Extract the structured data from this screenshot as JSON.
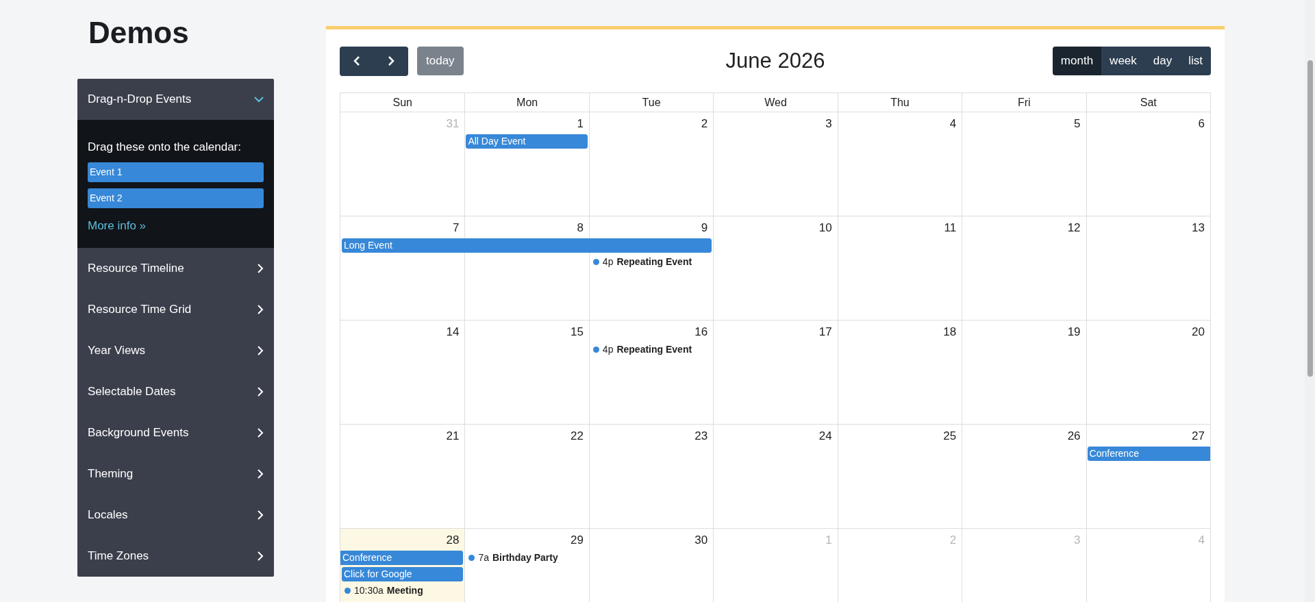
{
  "heading": "Demos",
  "sidebar": {
    "items": [
      {
        "label": "Drag-n-Drop Events",
        "expanded": true,
        "panel": {
          "intro": "Drag these onto the calendar:",
          "draggables": [
            "Event 1",
            "Event 2"
          ],
          "link": "More info »"
        }
      },
      {
        "label": "Resource Timeline",
        "expanded": false
      },
      {
        "label": "Resource Time Grid",
        "expanded": false
      },
      {
        "label": "Year Views",
        "expanded": false
      },
      {
        "label": "Selectable Dates",
        "expanded": false
      },
      {
        "label": "Background Events",
        "expanded": false
      },
      {
        "label": "Theming",
        "expanded": false
      },
      {
        "label": "Locales",
        "expanded": false
      },
      {
        "label": "Time Zones",
        "expanded": false
      }
    ]
  },
  "calendar": {
    "title": "June 2026",
    "today_button": {
      "label": "today",
      "disabled": true
    },
    "views": [
      {
        "label": "month",
        "selected": true
      },
      {
        "label": "week",
        "selected": false
      },
      {
        "label": "day",
        "selected": false
      },
      {
        "label": "list",
        "selected": false
      }
    ],
    "weekdays": [
      "Sun",
      "Mon",
      "Tue",
      "Wed",
      "Thu",
      "Fri",
      "Sat"
    ],
    "weeks": [
      {
        "days": [
          {
            "number": "31",
            "other_month": true,
            "today": false
          },
          {
            "number": "1",
            "other_month": false,
            "today": false
          },
          {
            "number": "2",
            "other_month": false,
            "today": false
          },
          {
            "number": "3",
            "other_month": false,
            "today": false
          },
          {
            "number": "4",
            "other_month": false,
            "today": false
          },
          {
            "number": "5",
            "other_month": false,
            "today": false
          },
          {
            "number": "6",
            "other_month": false,
            "today": false
          }
        ],
        "lanes": [
          [
            {
              "kind": "empty"
            },
            {
              "kind": "bar",
              "title": "All Day Event"
            },
            {
              "kind": "empty"
            },
            {
              "kind": "empty"
            },
            {
              "kind": "empty"
            },
            {
              "kind": "empty"
            },
            {
              "kind": "empty"
            }
          ]
        ]
      },
      {
        "days": [
          {
            "number": "7",
            "other_month": false,
            "today": false
          },
          {
            "number": "8",
            "other_month": false,
            "today": false
          },
          {
            "number": "9",
            "other_month": false,
            "today": false
          },
          {
            "number": "10",
            "other_month": false,
            "today": false
          },
          {
            "number": "11",
            "other_month": false,
            "today": false
          },
          {
            "number": "12",
            "other_month": false,
            "today": false
          },
          {
            "number": "13",
            "other_month": false,
            "today": false
          }
        ],
        "lanes": [
          [
            {
              "kind": "bar",
              "title": "Long Event"
            },
            {
              "kind": "bar_continued"
            },
            {
              "kind": "bar_continued"
            },
            {
              "kind": "empty"
            },
            {
              "kind": "empty"
            },
            {
              "kind": "empty"
            },
            {
              "kind": "empty"
            }
          ],
          [
            {
              "kind": "empty"
            },
            {
              "kind": "empty"
            },
            {
              "kind": "dot",
              "time": "4p",
              "title": "Repeating Event",
              "color": "#3788d8"
            },
            {
              "kind": "empty"
            },
            {
              "kind": "empty"
            },
            {
              "kind": "empty"
            },
            {
              "kind": "empty"
            }
          ]
        ]
      },
      {
        "days": [
          {
            "number": "14",
            "other_month": false,
            "today": false
          },
          {
            "number": "15",
            "other_month": false,
            "today": false
          },
          {
            "number": "16",
            "other_month": false,
            "today": false
          },
          {
            "number": "17",
            "other_month": false,
            "today": false
          },
          {
            "number": "18",
            "other_month": false,
            "today": false
          },
          {
            "number": "19",
            "other_month": false,
            "today": false
          },
          {
            "number": "20",
            "other_month": false,
            "today": false
          }
        ],
        "lanes": [
          [
            {
              "kind": "empty"
            },
            {
              "kind": "empty"
            },
            {
              "kind": "dot",
              "time": "4p",
              "title": "Repeating Event",
              "color": "#3788d8"
            },
            {
              "kind": "empty"
            },
            {
              "kind": "empty"
            },
            {
              "kind": "empty"
            },
            {
              "kind": "empty"
            }
          ]
        ]
      },
      {
        "days": [
          {
            "number": "21",
            "other_month": false,
            "today": false
          },
          {
            "number": "22",
            "other_month": false,
            "today": false
          },
          {
            "number": "23",
            "other_month": false,
            "today": false
          },
          {
            "number": "24",
            "other_month": false,
            "today": false
          },
          {
            "number": "25",
            "other_month": false,
            "today": false
          },
          {
            "number": "26",
            "other_month": false,
            "today": false
          },
          {
            "number": "27",
            "other_month": false,
            "today": false
          }
        ],
        "lanes": [
          [
            {
              "kind": "empty"
            },
            {
              "kind": "empty"
            },
            {
              "kind": "empty"
            },
            {
              "kind": "empty"
            },
            {
              "kind": "empty"
            },
            {
              "kind": "empty"
            },
            {
              "kind": "bar_open_end",
              "title": "Conference"
            }
          ]
        ]
      },
      {
        "days": [
          {
            "number": "28",
            "other_month": false,
            "today": true
          },
          {
            "number": "29",
            "other_month": false,
            "today": false
          },
          {
            "number": "30",
            "other_month": false,
            "today": false
          },
          {
            "number": "1",
            "other_month": true,
            "today": false
          },
          {
            "number": "2",
            "other_month": true,
            "today": false
          },
          {
            "number": "3",
            "other_month": true,
            "today": false
          },
          {
            "number": "4",
            "other_month": true,
            "today": false
          }
        ],
        "lanes": [
          [
            {
              "kind": "bar_open_start",
              "title": "Conference"
            },
            {
              "kind": "dot",
              "time": "7a",
              "title": "Birthday Party",
              "color": "#3788d8"
            },
            {
              "kind": "empty"
            },
            {
              "kind": "empty"
            },
            {
              "kind": "empty"
            },
            {
              "kind": "empty"
            },
            {
              "kind": "empty"
            }
          ],
          [
            {
              "kind": "bar",
              "title": "Click for Google"
            },
            {
              "kind": "empty"
            },
            {
              "kind": "empty"
            },
            {
              "kind": "empty"
            },
            {
              "kind": "empty"
            },
            {
              "kind": "empty"
            },
            {
              "kind": "empty"
            }
          ],
          [
            {
              "kind": "dot",
              "time": "10:30a",
              "title": "Meeting",
              "color": "#3788d8"
            },
            {
              "kind": "empty"
            },
            {
              "kind": "empty"
            },
            {
              "kind": "empty"
            },
            {
              "kind": "empty"
            },
            {
              "kind": "empty"
            },
            {
              "kind": "empty"
            }
          ]
        ]
      }
    ]
  }
}
